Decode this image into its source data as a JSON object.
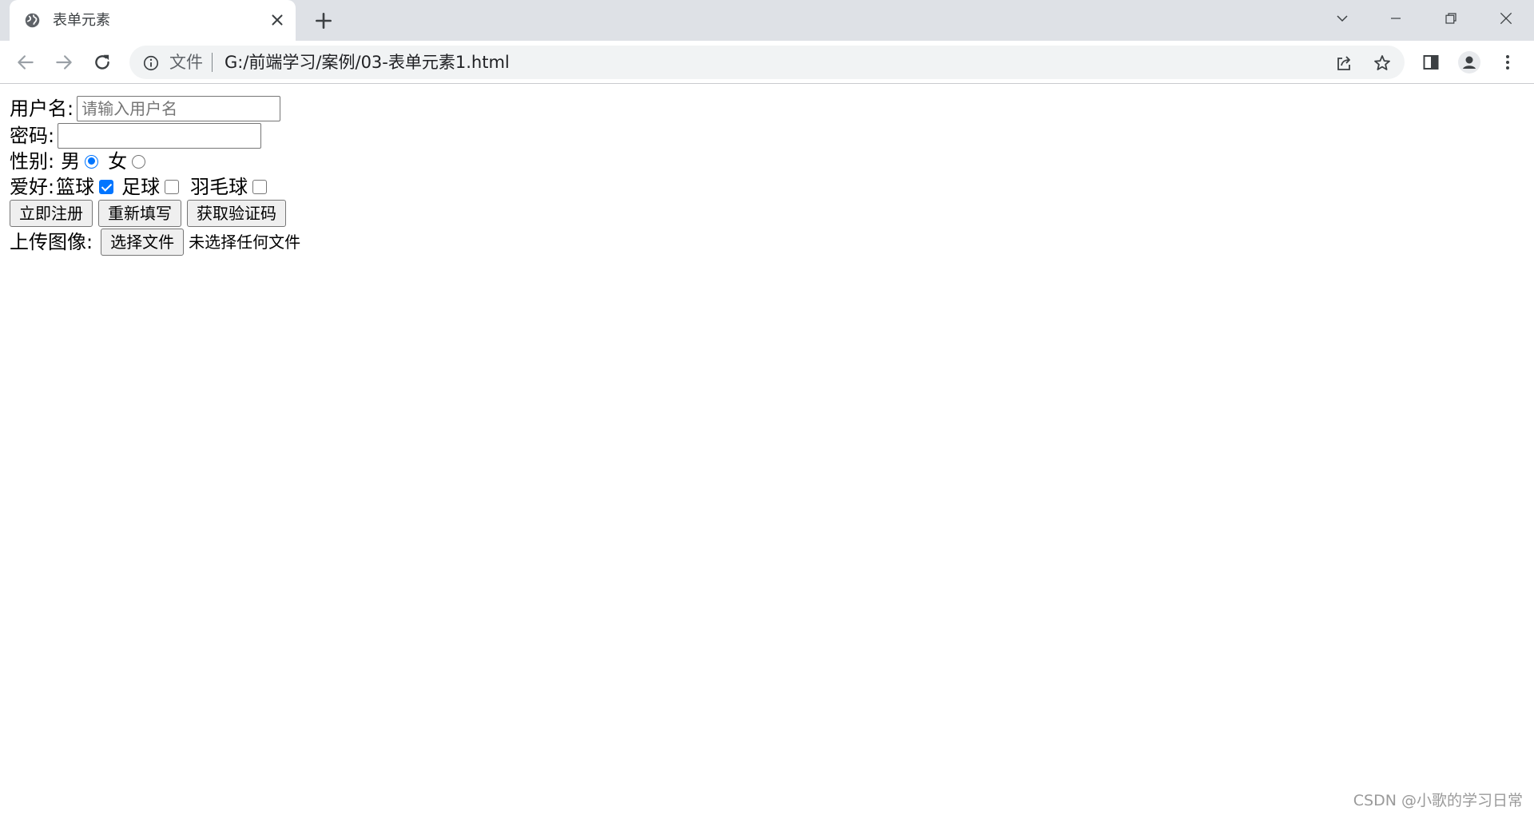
{
  "browser": {
    "tab_title": "表单元素",
    "scheme_label": "文件",
    "url": "G:/前端学习/案例/03-表单元素1.html"
  },
  "form": {
    "username_label": "用户名:",
    "username_placeholder": "请输入用户名",
    "password_label": "密码:",
    "gender_label": "性别:",
    "gender_options": [
      {
        "label": "男",
        "checked": true
      },
      {
        "label": "女",
        "checked": false
      }
    ],
    "hobby_label": "爱好:",
    "hobby_options": [
      {
        "label": "篮球",
        "checked": true
      },
      {
        "label": "足球",
        "checked": false
      },
      {
        "label": "羽毛球",
        "checked": false
      }
    ],
    "buttons": {
      "register": "立即注册",
      "reset": "重新填写",
      "get_code": "获取验证码"
    },
    "upload_label": "上传图像:",
    "choose_file_button": "选择文件",
    "file_status": "未选择任何文件"
  },
  "watermark": "CSDN @小歌的学习日常",
  "colors": {
    "tabstrip_bg": "#dee1e6",
    "omnibox_bg": "#f1f3f4",
    "accent": "#0075ff"
  }
}
